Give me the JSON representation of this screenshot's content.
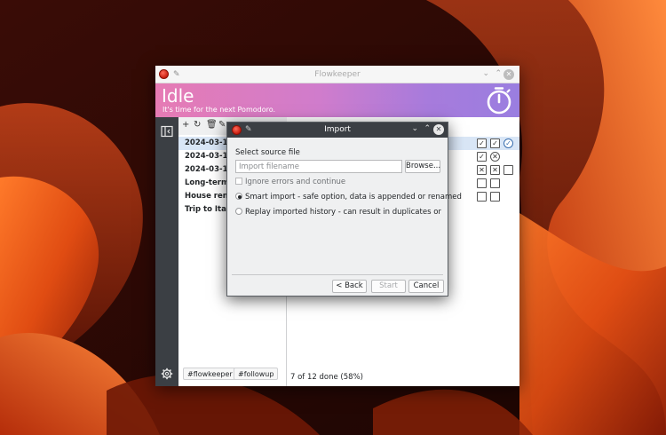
{
  "main_window": {
    "title": "Flowkeeper",
    "header": {
      "state": "Idle",
      "subtitle": "It's time for the next Pomodoro."
    },
    "backlogs": [
      {
        "label": "2024-03-14, ",
        "selected": true
      },
      {
        "label": "2024-03-13, ",
        "selected": false
      },
      {
        "label": "2024-03-12, ",
        "selected": false
      },
      {
        "label": "Long-term s",
        "selected": false
      },
      {
        "label": "House renov",
        "selected": false
      },
      {
        "label": "Trip to Italy",
        "selected": false
      }
    ],
    "tags": [
      "#flowkeeper",
      "#followup"
    ],
    "status": "7 of 12 done (58%)",
    "icons": {
      "toolbar": [
        "plus-icon",
        "refresh-icon",
        "delete-icon",
        "edit-icon"
      ],
      "sidebar": [
        "collapse-sidebar-icon",
        "settings-icon"
      ],
      "header": "timer-icon"
    },
    "pomodoro_rows": [
      [
        "done",
        "done",
        "running"
      ],
      [
        "done",
        "void"
      ],
      [
        "void",
        "void",
        "empty"
      ],
      [
        "empty",
        "empty"
      ],
      [
        "empty",
        "empty"
      ]
    ]
  },
  "dialog": {
    "title": "Import",
    "source_label": "Select source file",
    "filename_placeholder": "Import filename",
    "browse_label": "Browse...",
    "ignore_errors_label": "Ignore errors and continue",
    "smart_import_label": "Smart import - safe option, data is appended or renamed",
    "replay_label": "Replay imported history - can result in duplicates or deletio",
    "back_label": "< Back",
    "start_label": "Start",
    "cancel_label": "Cancel"
  },
  "colors": {
    "header_gradient_start": "#e67bb4",
    "header_gradient_end": "#9a7ee0",
    "sidebar": "#3b3f44",
    "selection": "#d9e6f6",
    "dialog_titlebar": "#3b3f44"
  }
}
